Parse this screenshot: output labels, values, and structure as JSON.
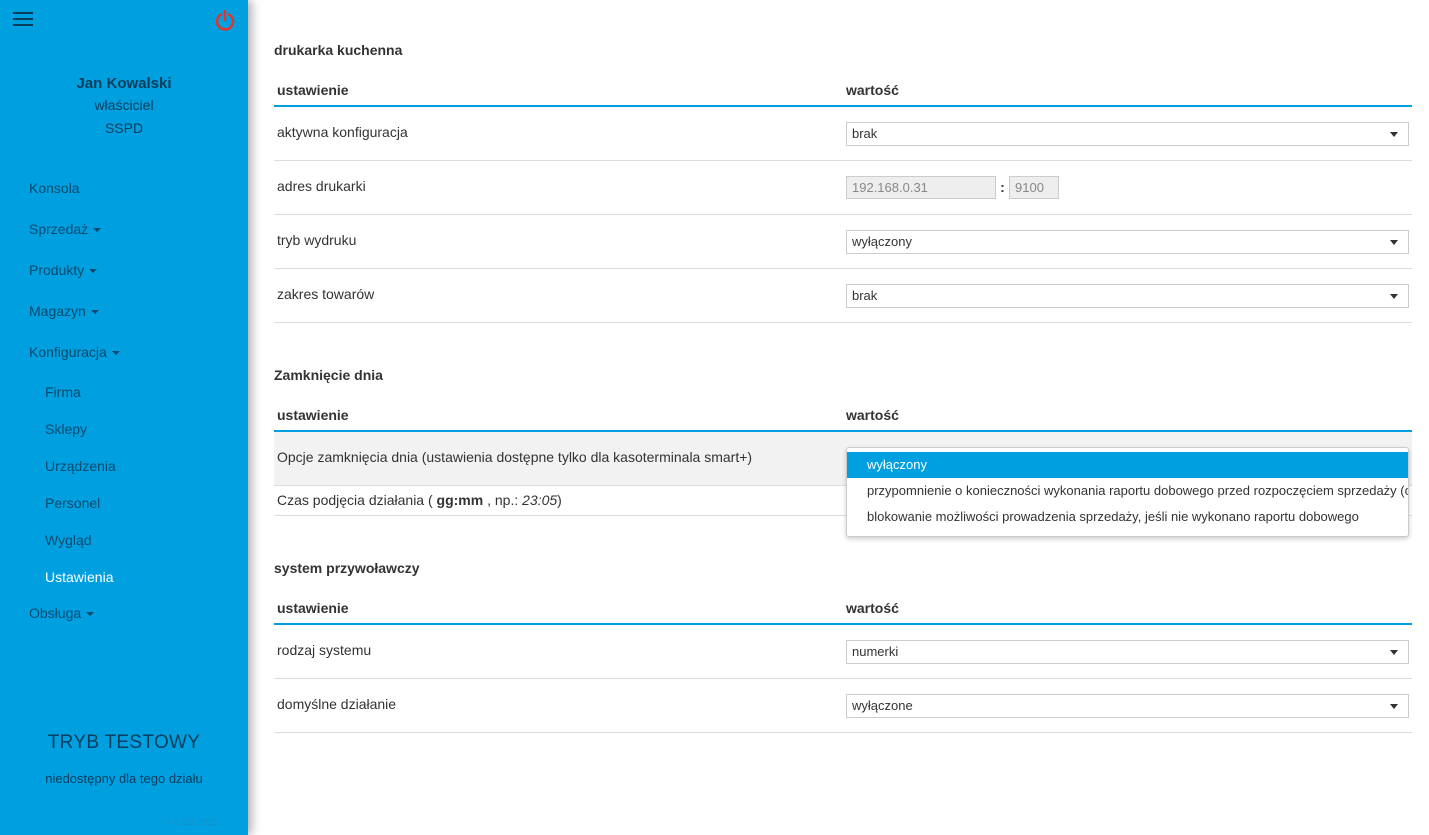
{
  "sidebar": {
    "user": {
      "name": "Jan Kowalski",
      "role": "właściciel",
      "shop": "SSPD"
    },
    "nav": {
      "konsola": "Konsola",
      "sprzedaz": "Sprzedaż",
      "produkty": "Produkty",
      "magazyn": "Magazyn",
      "konfiguracja": "Konfiguracja",
      "firma": "Firma",
      "sklepy": "Sklepy",
      "urzadzenia": "Urządzenia",
      "personel": "Personel",
      "wyglad": "Wygląd",
      "ustawienia": "Ustawienia",
      "obsluga": "Obsługa"
    },
    "test_mode": "TRYB TESTOWY",
    "test_note": "niedostępny dla tego działu",
    "version": "v. 6.111.2015"
  },
  "printer": {
    "title": "drukarka kuchenna",
    "col_setting": "ustawienie",
    "col_value": "wartość",
    "active_config_label": "aktywna konfiguracja",
    "active_config_value": "brak",
    "address_label": "adres drukarki",
    "address_ip": "192.168.0.31",
    "address_separator": ":",
    "address_port": "9100",
    "print_mode_label": "tryb wydruku",
    "print_mode_value": "wyłączony",
    "range_label": "zakres towarów",
    "range_value": "brak"
  },
  "day_close": {
    "title": "Zamknięcie dnia",
    "col_setting": "ustawienie",
    "col_value": "wartość",
    "options_label": "Opcje zamknięcia dnia (ustawienia dostępne tylko dla kasoterminala smart+)",
    "time_label_prefix": "Czas podjęcia działania (",
    "time_label_format": "gg:mm",
    "time_label_mid": ", np.:",
    "time_label_example": "23:05",
    "time_label_suffix": ")",
    "dropdown_options": [
      "wyłączony",
      "przypomnienie o konieczności wykonania raportu dobowego przed rozpoczęciem sprzedaży (o ok",
      "blokowanie możliwości prowadzenia sprzedaży, jeśli nie wykonano raportu dobowego"
    ]
  },
  "call_system": {
    "title": "system przywoławczy",
    "col_setting": "ustawienie",
    "col_value": "wartość",
    "type_label": "rodzaj systemu",
    "type_value": "numerki",
    "default_label": "domyślne działanie",
    "default_value": "wyłączone"
  },
  "colors": {
    "accent": "#009fdf",
    "power": "#e5332a",
    "sidebar_text": "#0b3d5c"
  },
  "icons": {
    "menu": "hamburger-icon",
    "power": "power-icon",
    "dropdown": "caret-down-icon"
  }
}
